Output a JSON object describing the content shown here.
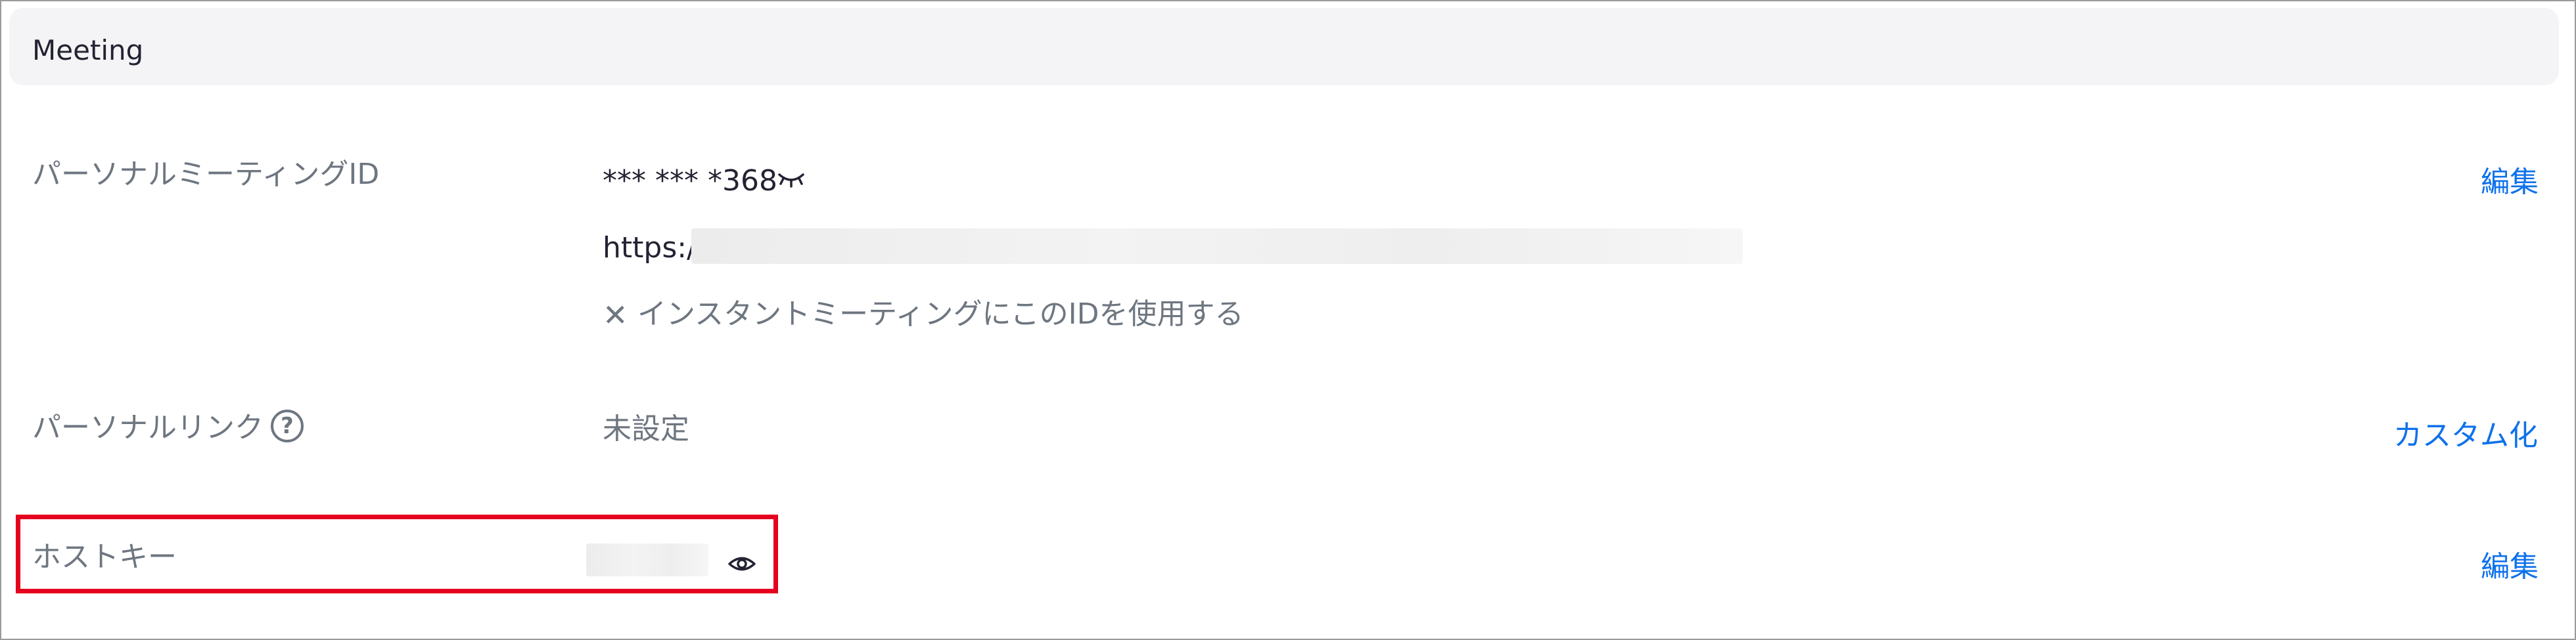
{
  "section": {
    "title": "Meeting"
  },
  "personal_meeting_id": {
    "label": "パーソナルミーティングID",
    "masked_id": "*** *** *368",
    "url_prefix": "https://",
    "checkbox_mark": "✕",
    "checkbox_label": "インスタントミーティングにこのIDを使用する",
    "action": "編集"
  },
  "personal_link": {
    "label": "パーソナルリンク",
    "help_glyph": "?",
    "value": "未設定",
    "action": "カスタム化"
  },
  "host_key": {
    "label": "ホストキー",
    "action": "編集"
  },
  "icons": {
    "reveal_id": "eye-closed-icon",
    "help": "question-circle-icon",
    "reveal_host_key": "eye-icon"
  },
  "colors": {
    "link": "#0e71eb",
    "highlight": "#e4001e",
    "label": "#6e7680",
    "text": "#232333",
    "header_bg": "#f4f4f6"
  }
}
